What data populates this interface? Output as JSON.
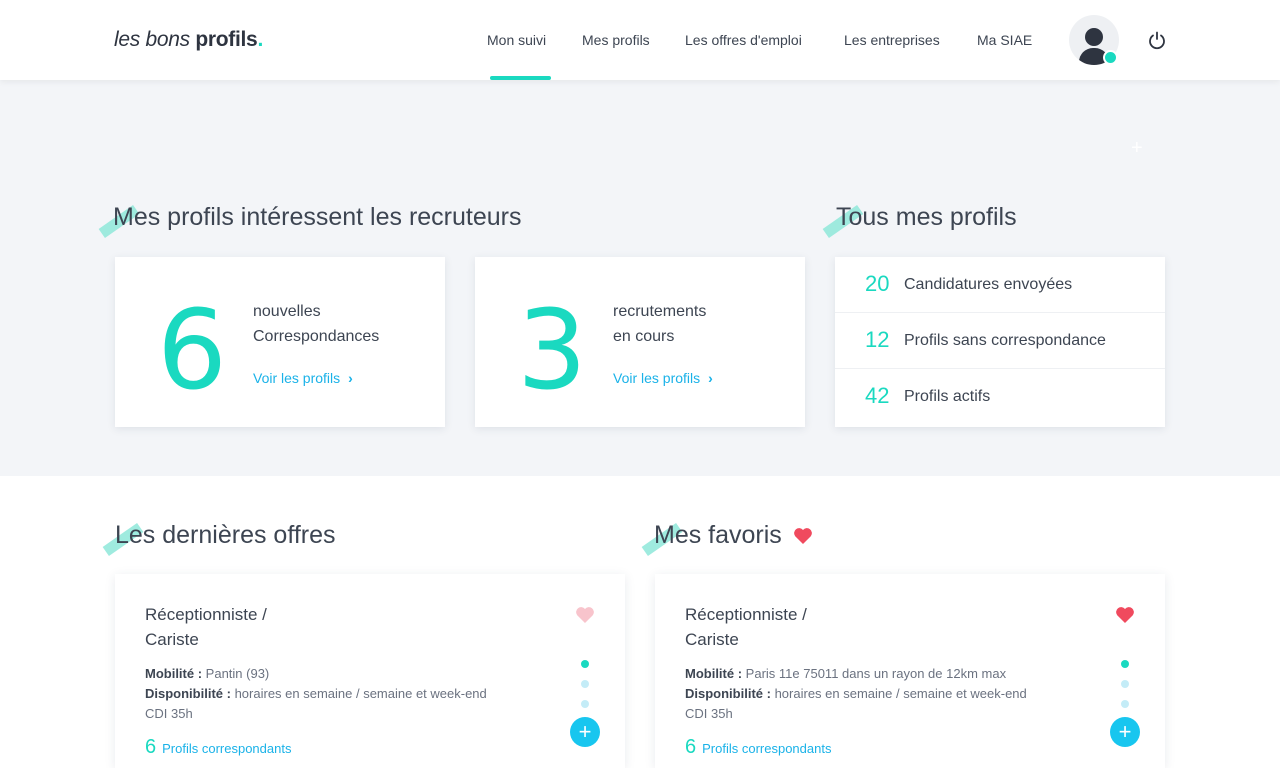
{
  "brand": {
    "light": "les bons ",
    "bold": "profils",
    "dot": "."
  },
  "nav": [
    {
      "label": "Mon suivi",
      "active": true
    },
    {
      "label": "Mes profils"
    },
    {
      "label": "Les offres d'emploi"
    },
    {
      "label": "Les entreprises"
    },
    {
      "label": "Ma SIAE"
    }
  ],
  "colors": {
    "accent": "#1ad9c0",
    "link": "#1ab2e8",
    "heart": "#f04a5e",
    "heart_light": "#f8c4cc"
  },
  "icons": {
    "power": "power-icon",
    "avatar": "user-avatar-icon",
    "plus": "plus-icon",
    "heart": "heart-icon",
    "chevron": "chevron-right-icon"
  },
  "interest": {
    "title": "Mes profils intéressent les recruteurs",
    "cards": [
      {
        "number": "6",
        "line1": "nouvelles",
        "line2": "Correspondances",
        "link": "Voir les profils"
      },
      {
        "number": "3",
        "line1": "recrutements",
        "line2": "en cours",
        "link": "Voir les profils"
      }
    ]
  },
  "all_profiles": {
    "title": "Tous mes profils",
    "stats": [
      {
        "num": "20",
        "label": "Candidatures envoyées"
      },
      {
        "num": "12",
        "label": "Profils sans correspondance"
      },
      {
        "num": "42",
        "label": "Profils actifs"
      }
    ]
  },
  "offers": {
    "title": "Les dernières offres",
    "card": {
      "title_line1": "Réceptionniste /",
      "title_line2": "Cariste",
      "mobility_label": "Mobilité :",
      "mobility": "Pantin (93)",
      "availability_label": "Disponibilité :",
      "availability": "horaires en semaine / semaine et week-end",
      "contract": "CDI 35h",
      "match_count": "6",
      "match_label": "Profils correspondants",
      "favorited": false
    }
  },
  "favorites": {
    "title": "Mes favoris",
    "card": {
      "title_line1": "Réceptionniste /",
      "title_line2": "Cariste",
      "mobility_label": "Mobilité :",
      "mobility": "Paris 11e 75011 dans un rayon de 12km max",
      "availability_label": "Disponibilité :",
      "availability": "horaires en semaine / semaine et week-end",
      "contract": "CDI 35h",
      "match_count": "6",
      "match_label": "Profils correspondants",
      "favorited": true
    }
  }
}
